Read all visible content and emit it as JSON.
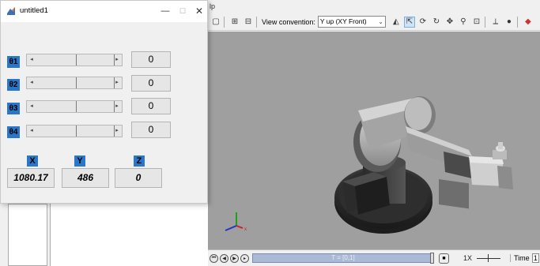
{
  "figure": {
    "title": "untitled1",
    "window_buttons": {
      "minimize": "—",
      "maximize": "☐",
      "close": "✕"
    },
    "joints": [
      {
        "label": "θ1",
        "value": "0"
      },
      {
        "label": "θ2",
        "value": "0"
      },
      {
        "label": "θ3",
        "value": "0"
      },
      {
        "label": "θ4",
        "value": "0"
      }
    ],
    "coords": [
      {
        "axis": "X",
        "value": "1080.17"
      },
      {
        "axis": "Y",
        "value": "486"
      },
      {
        "axis": "Z",
        "value": "0"
      }
    ],
    "slider_arrows": {
      "left": "◂",
      "right": "▸"
    }
  },
  "explorer": {
    "topstrip_text": "lp",
    "toolbar": {
      "view_convention_label": "View convention:",
      "view_convention_value": "Y up (XY Front)",
      "icons": [
        "frame-icon",
        "fit-icon",
        "snap-icon",
        "zoom-fit-icon",
        "select-icon",
        "rotate-icon",
        "orbit-icon",
        "pan-icon",
        "zoom-icon",
        "zoom-box-icon",
        "axes-icon",
        "globe-icon",
        "highlight-icon"
      ]
    },
    "triad_label": "x",
    "playback": {
      "time_track": "T = [0,1]",
      "speed": "1X",
      "time_label": "Time",
      "time_value": "1"
    }
  }
}
